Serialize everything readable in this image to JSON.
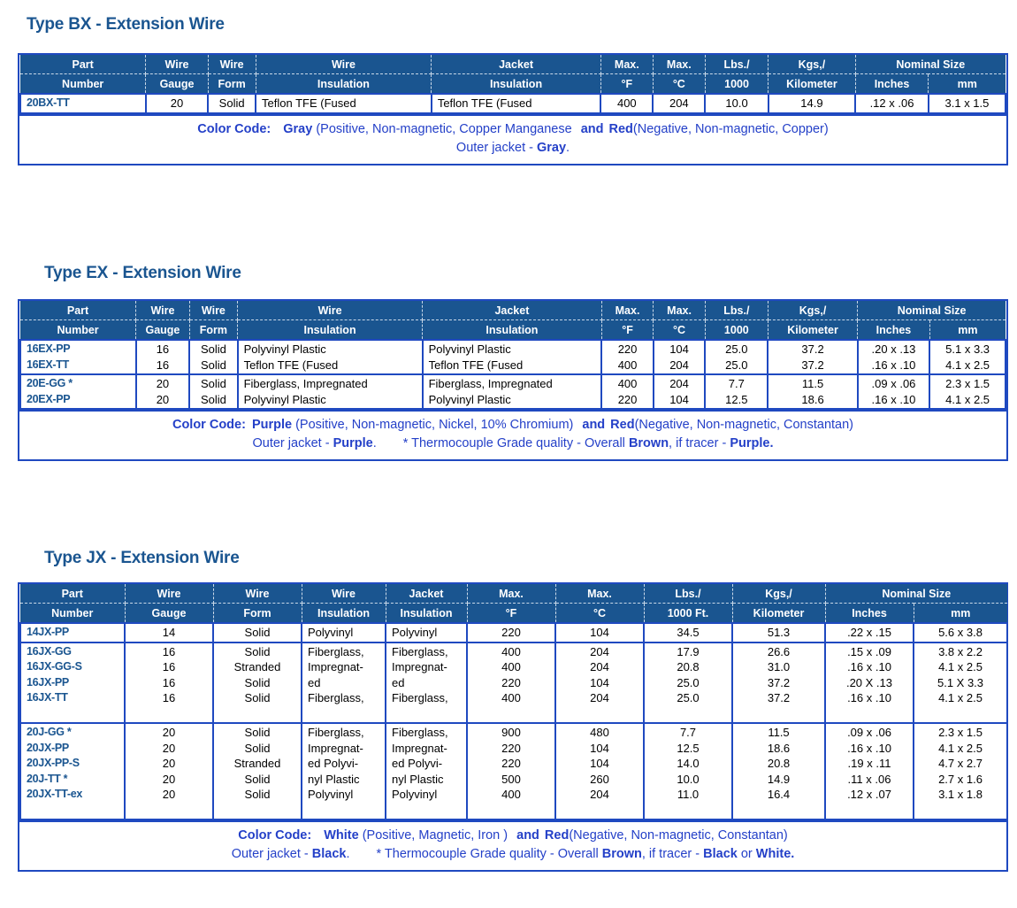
{
  "document": {
    "theme": {
      "header_bg": "#1a5590",
      "cell_border": "#1f49c0",
      "title_color": "#1a5590",
      "footer_text": "#2440c8",
      "part_number_color": "#1a5590"
    }
  },
  "sections": [
    {
      "id": "bx",
      "title": "Type BX - Extension Wire",
      "headers": {
        "top": [
          "Part",
          "Wire",
          "Wire",
          "Wire",
          "Jacket",
          "Max.",
          "Max.",
          "Lbs./",
          "Kgs,/",
          "Nominal Size"
        ],
        "bottom": [
          "Number",
          "Gauge",
          "Form",
          "Insulation",
          "Insulation",
          "°F",
          "°C",
          "1000",
          "Kilometer",
          "Inches",
          "mm"
        ]
      },
      "groups": [
        {
          "rows": [
            {
              "part_number": "20BX-TT",
              "wire_gauge": "20",
              "wire_form": "Solid",
              "wire_insulation": "Teflon TFE (Fused",
              "jacket_insulation": "Teflon TFE (Fused",
              "max_f": "400",
              "max_c": "204",
              "lbs_1000": "10.0",
              "kgs_km": "14.9",
              "nominal_inches": ".12 x .06",
              "nominal_mm": "3.1 x 1.5"
            }
          ]
        }
      ],
      "color_code": {
        "label": "Color Code:",
        "positive_color": "Gray",
        "positive_detail": "(Positive, Non-magnetic, Copper Manganese",
        "conjunction": "and",
        "negative_color": "Red",
        "negative_detail": "(Negative, Non-magnetic, Copper)",
        "outer_jacket_label": "Outer jacket -",
        "outer_jacket_color": "Gray",
        "outer_jacket_end": ".",
        "note": ""
      }
    },
    {
      "id": "ex",
      "title": "Type EX - Extension Wire",
      "headers": {
        "top": [
          "Part",
          "Wire",
          "Wire",
          "Wire",
          "Jacket",
          "Max.",
          "Max.",
          "Lbs./",
          "Kgs,/",
          "Nominal Size"
        ],
        "bottom": [
          "Number",
          "Gauge",
          "Form",
          "Insulation",
          "Insulation",
          "°F",
          "°C",
          "1000",
          "Kilometer",
          "Inches",
          "mm"
        ]
      },
      "groups": [
        {
          "part_numbers": [
            "16EX-PP",
            "16EX-TT"
          ],
          "wire_gauge": [
            "16",
            "16"
          ],
          "wire_form": [
            "Solid",
            "Solid"
          ],
          "wire_insulation": [
            "Polyvinyl Plastic",
            "Teflon TFE (Fused"
          ],
          "jacket_insulation": [
            "Polyvinyl Plastic",
            "Teflon TFE (Fused"
          ],
          "max_f": [
            "220",
            "400"
          ],
          "max_c": [
            "104",
            "204"
          ],
          "lbs_1000": [
            "25.0",
            "25.0"
          ],
          "kgs_km": [
            "37.2",
            "37.2"
          ],
          "nominal_inches": [
            ".20 x .13",
            ".16 x .10"
          ],
          "nominal_mm": [
            "5.1 x 3.3",
            "4.1 x 2.5"
          ]
        },
        {
          "part_numbers": [
            "20E-GG *",
            "20EX-PP"
          ],
          "wire_gauge": [
            "20",
            "20"
          ],
          "wire_form": [
            "Solid",
            "Solid"
          ],
          "wire_insulation": [
            "Fiberglass, Impregnated",
            "Polyvinyl Plastic"
          ],
          "jacket_insulation": [
            "Fiberglass, Impregnated",
            "Polyvinyl Plastic"
          ],
          "max_f": [
            "400",
            "220"
          ],
          "max_c": [
            "204",
            "104"
          ],
          "lbs_1000": [
            "7.7",
            "12.5"
          ],
          "kgs_km": [
            "11.5",
            "18.6"
          ],
          "nominal_inches": [
            ".09 x .06",
            ".16 x .10"
          ],
          "nominal_mm": [
            "2.3 x 1.5",
            "4.1 x 2.5"
          ]
        }
      ],
      "color_code": {
        "label": "Color Code:",
        "positive_color": "Purple",
        "positive_detail": "(Positive, Non-magnetic, Nickel, 10% Chromium)",
        "conjunction": "and",
        "negative_color": "Red",
        "negative_detail": "(Negative, Non-magnetic, Constantan)",
        "outer_jacket_label": "Outer jacket -",
        "outer_jacket_color": "Purple",
        "outer_jacket_end": ".",
        "note_prefix": "* Thermocouple Grade quality - Overall",
        "note_color_1": "Brown",
        "note_middle": ", if tracer -",
        "note_color_2": "Purple.",
        "note_end": ""
      }
    },
    {
      "id": "jx",
      "title": "Type JX - Extension Wire",
      "headers": {
        "top": [
          "Part",
          "Wire",
          "Wire",
          "Wire",
          "Jacket",
          "Max.",
          "Max.",
          "Lbs./",
          "Kgs,/",
          "Nominal Size"
        ],
        "bottom": [
          "Number",
          "Gauge",
          "Form",
          "Insulation",
          "Insulation",
          "°F",
          "°C",
          "1000 Ft.",
          "Kilometer",
          "Inches",
          "mm"
        ]
      },
      "groups": [
        {
          "part_numbers": [
            "14JX-PP"
          ],
          "wire_gauge": [
            "14"
          ],
          "wire_form": [
            "Solid"
          ],
          "wire_insulation": [
            "Polyvinyl"
          ],
          "jacket_insulation": [
            "Polyvinyl"
          ],
          "max_f": [
            "220"
          ],
          "max_c": [
            "104"
          ],
          "lbs_1000": [
            "34.5"
          ],
          "kgs_km": [
            "51.3"
          ],
          "nominal_inches": [
            ".22 x .15"
          ],
          "nominal_mm": [
            "5.6 x 3.8"
          ]
        },
        {
          "part_numbers": [
            "16JX-GG",
            "16JX-GG-S",
            "16JX-PP",
            "16JX-TT"
          ],
          "wire_gauge": [
            "16",
            "16",
            "16",
            "16"
          ],
          "wire_form": [
            "Solid",
            "Stranded",
            "Solid",
            "Solid"
          ],
          "wire_insulation": [
            "Fiberglass,",
            "Impregnat-",
            "ed",
            "Fiberglass,"
          ],
          "jacket_insulation": [
            "Fiberglass,",
            "Impregnat-",
            "ed",
            "Fiberglass,"
          ],
          "max_f": [
            "400",
            "400",
            "220",
            "400"
          ],
          "max_c": [
            "204",
            "204",
            "104",
            "204"
          ],
          "lbs_1000": [
            "17.9",
            "20.8",
            "25.0",
            "25.0"
          ],
          "kgs_km": [
            "26.6",
            "31.0",
            "37.2",
            "37.2"
          ],
          "nominal_inches": [
            ".15 x .09",
            ".16 x .10",
            ".20 X .13",
            ".16 x .10"
          ],
          "nominal_mm": [
            "3.8 x 2.2",
            "4.1 x 2.5",
            "5.1 X 3.3",
            "4.1 x 2.5"
          ]
        },
        {
          "part_numbers": [
            "20J-GG *",
            "20JX-PP",
            "20JX-PP-S",
            "20J-TT *",
            "20JX-TT-ex"
          ],
          "wire_gauge": [
            "20",
            "20",
            "20",
            "20",
            "20"
          ],
          "wire_form": [
            "Solid",
            "Solid",
            "Stranded",
            "Solid",
            "Solid"
          ],
          "wire_insulation": [
            "Fiberglass,",
            "Impregnat-",
            "ed Polyvi-",
            "nyl Plastic",
            "Polyvinyl"
          ],
          "jacket_insulation": [
            "Fiberglass,",
            "Impregnat-",
            "ed Polyvi-",
            "nyl Plastic",
            "Polyvinyl"
          ],
          "max_f": [
            "900",
            "220",
            "220",
            "500",
            "400"
          ],
          "max_c": [
            "480",
            "104",
            "104",
            "260",
            "204"
          ],
          "lbs_1000": [
            "7.7",
            "12.5",
            "14.0",
            "10.0",
            "11.0"
          ],
          "kgs_km": [
            "11.5",
            "18.6",
            "20.8",
            "14.9",
            "16.4"
          ],
          "nominal_inches": [
            ".09 x .06",
            ".16 x .10",
            ".19 x .11",
            ".11 x .06",
            ".12 x .07"
          ],
          "nominal_mm": [
            "2.3 x 1.5",
            "4.1 x 2.5",
            "4.7 x 2.7",
            "2.7 x 1.6",
            "3.1 x 1.8"
          ]
        }
      ],
      "color_code": {
        "label": "Color Code:",
        "positive_color": "White",
        "positive_detail": "(Positive, Magnetic, Iron )",
        "conjunction": "and",
        "negative_color": "Red",
        "negative_detail": "(Negative, Non-magnetic, Constantan)",
        "outer_jacket_label": "Outer jacket -",
        "outer_jacket_color": "Black",
        "outer_jacket_end": ".",
        "note_prefix": "* Thermocouple Grade quality - Overall",
        "note_color_1": "Brown",
        "note_middle": ", if tracer -",
        "note_color_2": "Black",
        "note_or": "or",
        "note_color_3": "White."
      }
    }
  ]
}
